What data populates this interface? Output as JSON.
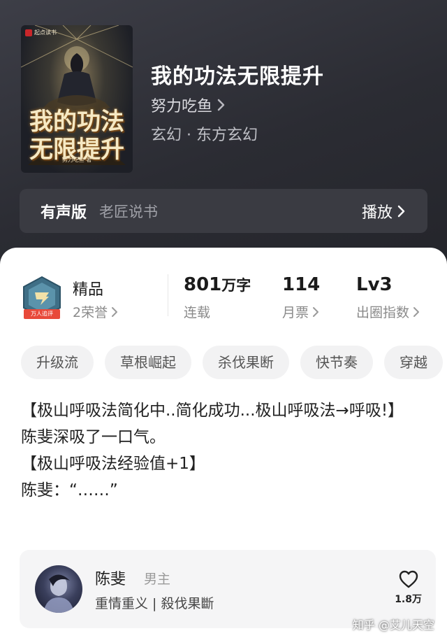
{
  "cover": {
    "brand": "起点读书",
    "title_line1": "我的功法",
    "title_line2": "无限提升",
    "author": "努力吃鱼 著"
  },
  "book": {
    "title": "我的功法无限提升",
    "author": "努力吃鱼",
    "genre": "玄幻 · 东方玄幻"
  },
  "audio": {
    "label": "有声版",
    "narrator": "老匠说书",
    "play_label": "播放"
  },
  "stats": {
    "badge_ribbon": "万人追评",
    "quality_label": "精品",
    "honors": "2荣誉",
    "words_value": "801",
    "words_unit": "万字",
    "status": "连载",
    "monthly_votes_value": "114",
    "monthly_votes_label": "月票",
    "level_value": "Lv3",
    "level_label": "出圈指数"
  },
  "tags": [
    "升级流",
    "草根崛起",
    "杀伐果断",
    "快节奏",
    "穿越"
  ],
  "description": [
    "【极山呼吸法简化中..简化成功...极山呼吸法→呼吸!】",
    "陈斐深吸了一口气。",
    "【极山呼吸法经验值+1】",
    "陈斐：“……”"
  ],
  "character": {
    "name": "陈斐",
    "role": "男主",
    "traits": "重情重义 | 殺伐果斷",
    "likes": "1.8万"
  },
  "watermark": "知乎 @艾儿天空",
  "icons": [
    "chevron-right-icon",
    "heart-icon",
    "honor-badge-icon"
  ],
  "colors": {
    "hero_bg": "#2b2c33",
    "audio_bar": "#3a3b42",
    "tag_bg": "#f2f2f3",
    "card_bg": "#f5f5f6"
  }
}
